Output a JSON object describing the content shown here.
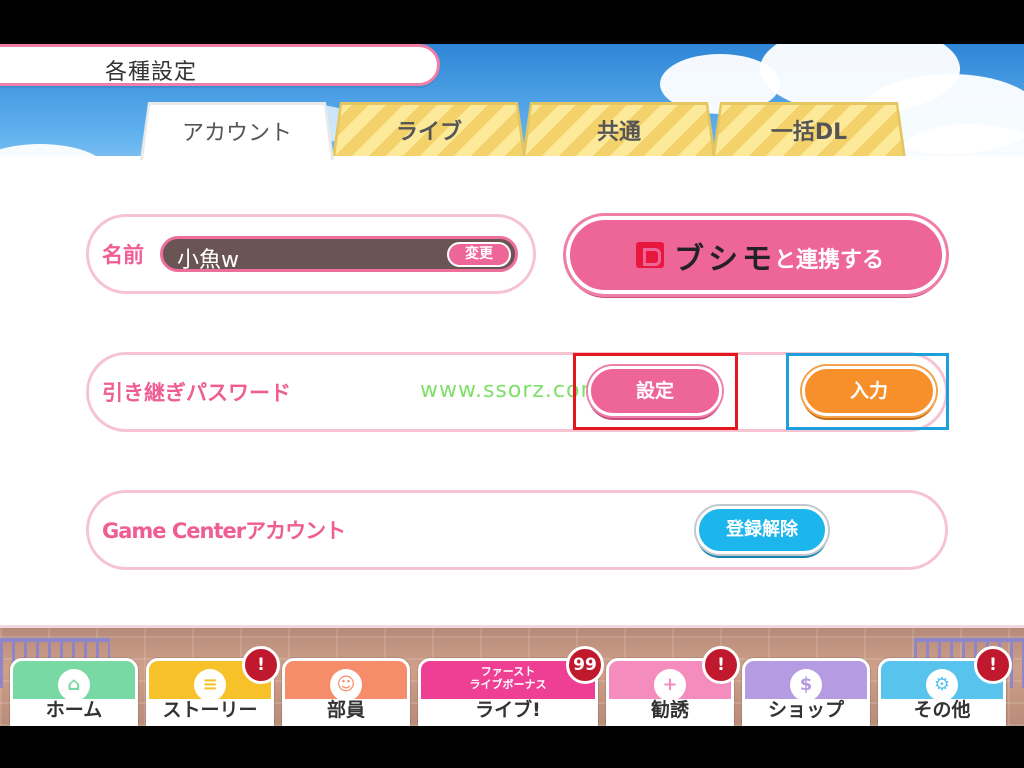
{
  "header": {
    "title": "各種設定"
  },
  "tabs": [
    {
      "label": "アカウント",
      "active": true
    },
    {
      "label": "ライブ",
      "active": false
    },
    {
      "label": "共通",
      "active": false
    },
    {
      "label": "一括DL",
      "active": false
    }
  ],
  "account": {
    "name_label": "名前",
    "name_value": "小魚w",
    "change_button": "変更",
    "bushimo_logo": "ブシモ",
    "bushimo_suffix": "と連携する",
    "password_label": "引き継ぎパスワード",
    "set_button": "設定",
    "input_button": "入力",
    "gamecenter_label": "Game Centerアカウント",
    "unregister_button": "登録解除"
  },
  "watermark": "www.ssorz.com",
  "bottom_nav": [
    {
      "label": "ホーム",
      "icon": "home-icon",
      "color": "#79d9a4",
      "badge": ""
    },
    {
      "label": "ストーリー",
      "icon": "speech-bubble-icon",
      "color": "#f7c12a",
      "badge": "!"
    },
    {
      "label": "部員",
      "icon": "member-icon",
      "color": "#f58d6b",
      "badge": ""
    },
    {
      "label": "ライブ!",
      "icon": "live-icon",
      "color": "#ee3f94",
      "badge": "99",
      "banner": "ファースト\nライブボーナス"
    },
    {
      "label": "勧誘",
      "icon": "scout-icon",
      "color": "#f48cbd",
      "badge": "!"
    },
    {
      "label": "ショップ",
      "icon": "dollar-icon",
      "color": "#b49be2",
      "badge": ""
    },
    {
      "label": "その他",
      "icon": "gear-icon",
      "color": "#58c4ee",
      "badge": "!"
    }
  ]
}
